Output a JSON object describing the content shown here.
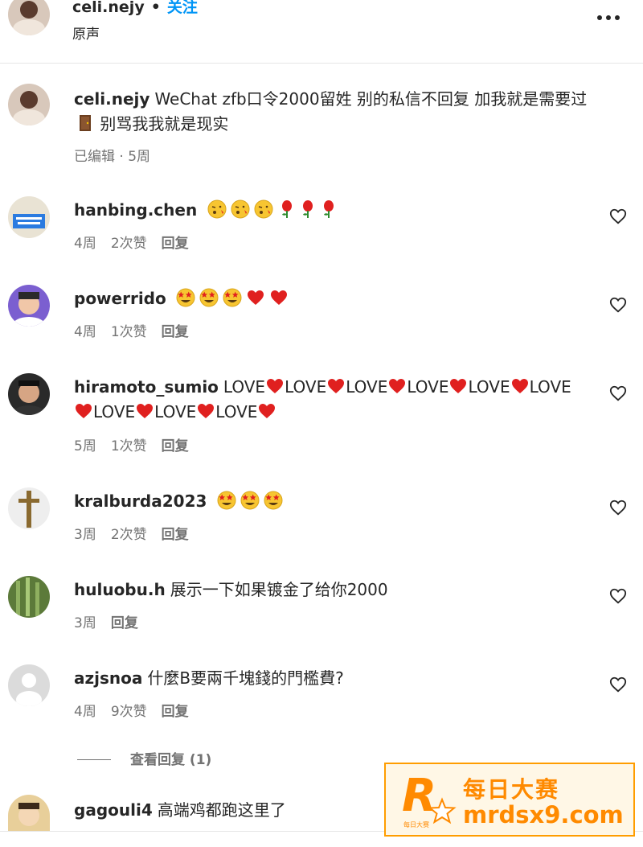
{
  "header": {
    "username": "celi.nejy",
    "follow_label": "关注",
    "subtitle": "原声",
    "more_icon": "more-horizontal-icon"
  },
  "caption": {
    "username": "celi.nejy",
    "text_part1": "WeChat zfb口令2000留姓 别的私信不回复 加我就是需要过",
    "text_part2": " 别骂我我就是现实",
    "door_icon": "door-icon",
    "meta": "已编辑 · 5周"
  },
  "comments": [
    {
      "username": "hanbing.chen",
      "text": "",
      "emojis": [
        "kiss-face",
        "kiss-face",
        "kiss-face",
        "rose",
        "rose",
        "rose"
      ],
      "time": "4周",
      "likes": "2次赞",
      "reply": "回复"
    },
    {
      "username": "powerrido",
      "text": "",
      "emojis": [
        "star-eyes",
        "star-eyes",
        "star-eyes",
        "heart",
        "heart"
      ],
      "time": "4周",
      "likes": "1次赞",
      "reply": "回复"
    },
    {
      "username": "hiramoto_sumio",
      "text": "",
      "time": "5周",
      "likes": "1次赞",
      "reply": "回复",
      "love_word": "LOVE"
    },
    {
      "username": "kralburda2023",
      "text": "",
      "emojis": [
        "star-eyes",
        "star-eyes",
        "star-eyes"
      ],
      "time": "3周",
      "likes": "2次赞",
      "reply": "回复"
    },
    {
      "username": "huluobu.h",
      "text": "展示一下如果镀金了给你2000",
      "time": "3周",
      "likes": "",
      "reply": "回复"
    },
    {
      "username": "azjsnoa",
      "text": "什麼B要兩千塊錢的門檻費?",
      "time": "4周",
      "likes": "9次赞",
      "reply": "回复"
    },
    {
      "username": "gagouli4",
      "text": "高端鸡都跑这里了"
    }
  ],
  "view_replies": "查看回复 (1)",
  "watermark": {
    "cn": "每日大赛",
    "url": "mrdsx9.com",
    "logo_text": "R",
    "logo_small": "每日大赛"
  },
  "colors": {
    "accent": "#0095f6",
    "meta": "#737373",
    "watermark": "#ff8a00",
    "heart_red": "#e0201f"
  }
}
